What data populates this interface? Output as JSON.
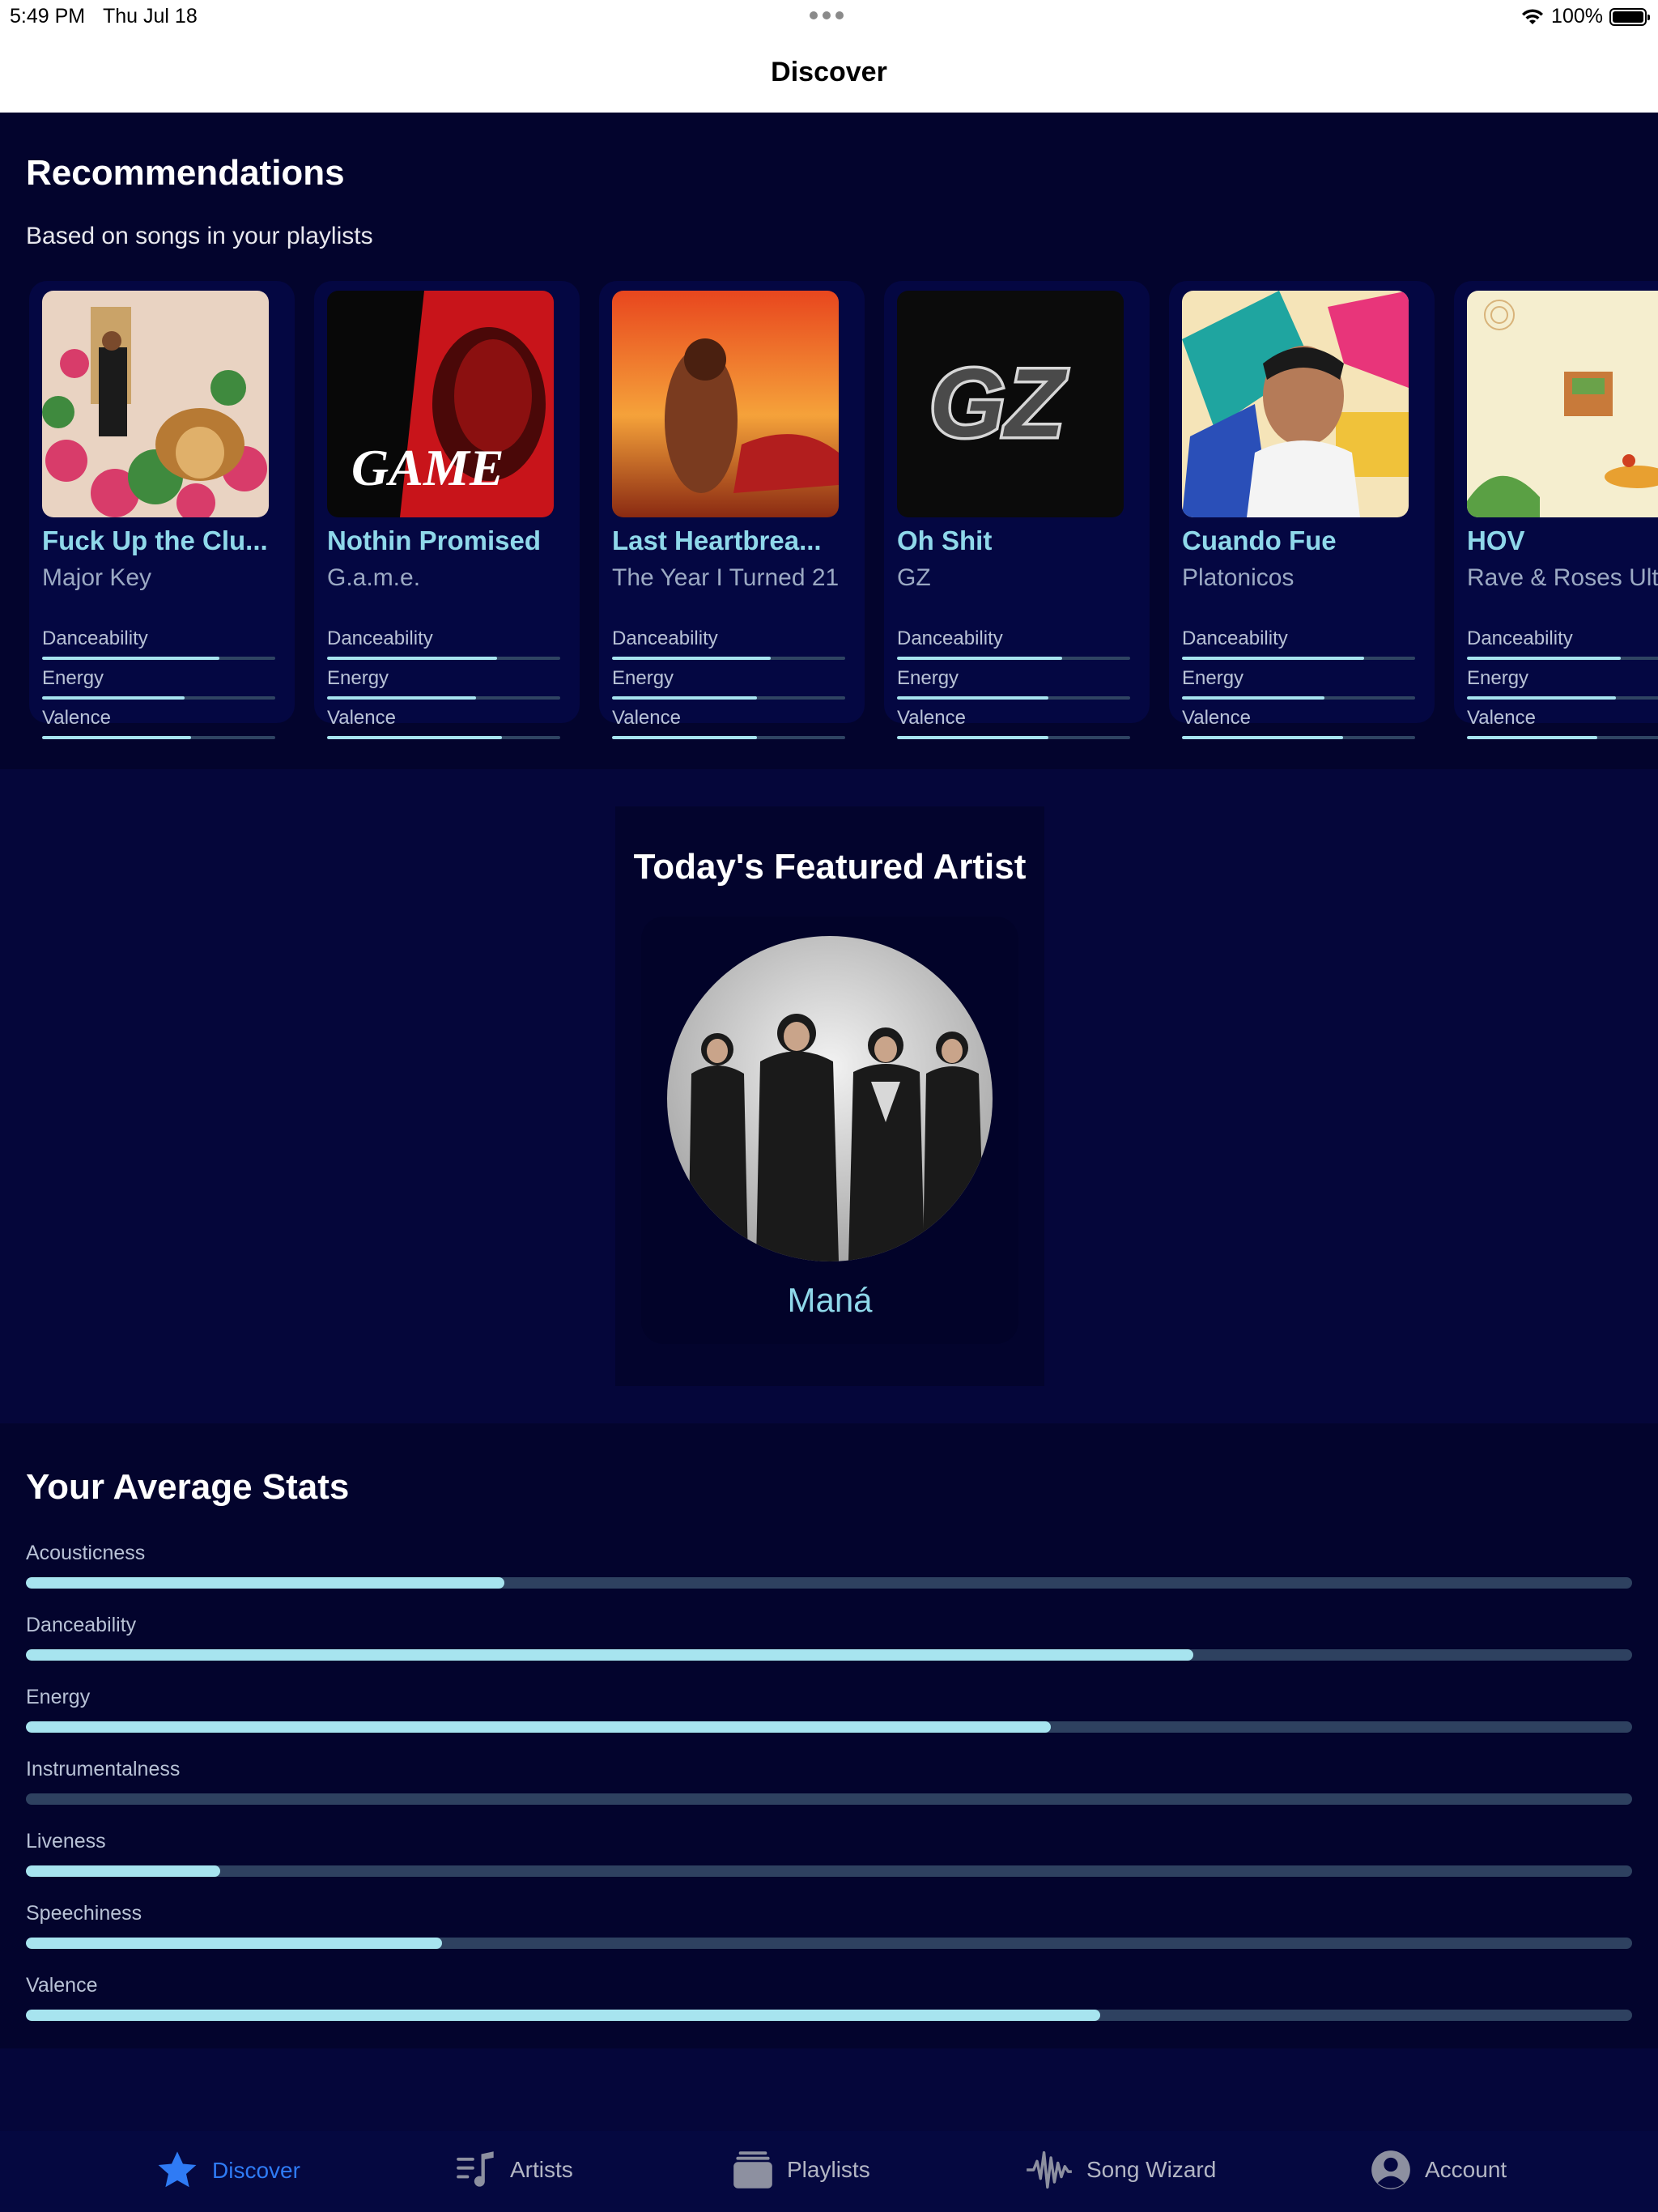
{
  "status": {
    "time": "5:49 PM",
    "date": "Thu Jul 18",
    "battery": "100%",
    "battery_level": 1.0
  },
  "nav": {
    "title": "Discover"
  },
  "recommendations": {
    "title": "Recommendations",
    "subtitle": "Based on songs in your playlists",
    "feature_labels": [
      "Danceability",
      "Energy",
      "Valence"
    ],
    "cards": [
      {
        "title": "Fuck Up the Clu...",
        "artist": "Major Key",
        "danceability": 0.76,
        "energy": 0.61,
        "valence": 0.64,
        "art": "garden"
      },
      {
        "title": "Nothin Promised",
        "artist": "G.a.m.e.",
        "danceability": 0.73,
        "energy": 0.64,
        "valence": 0.75,
        "art": "game"
      },
      {
        "title": "Last Heartbrea...",
        "artist": "The Year I Turned 21",
        "danceability": 0.68,
        "energy": 0.62,
        "valence": 0.62,
        "art": "sunset"
      },
      {
        "title": "Oh Shit",
        "artist": "GZ",
        "danceability": 0.71,
        "energy": 0.65,
        "valence": 0.65,
        "art": "chrome"
      },
      {
        "title": "Cuando Fue",
        "artist": "Platonicos",
        "danceability": 0.78,
        "energy": 0.61,
        "valence": 0.69,
        "art": "collage"
      },
      {
        "title": "HOV",
        "artist": "Rave & Roses Ultra",
        "danceability": 0.66,
        "energy": 0.64,
        "valence": 0.56,
        "art": "cream"
      }
    ]
  },
  "featured": {
    "title": "Today's Featured Artist",
    "artist": "Maná"
  },
  "stats": {
    "title": "Your Average Stats",
    "items": [
      {
        "label": "Acousticness",
        "value": 0.298
      },
      {
        "label": "Danceability",
        "value": 0.727
      },
      {
        "label": "Energy",
        "value": 0.638
      },
      {
        "label": "Instrumentalness",
        "value": 0.0
      },
      {
        "label": "Liveness",
        "value": 0.121
      },
      {
        "label": "Speechiness",
        "value": 0.259
      },
      {
        "label": "Valence",
        "value": 0.669
      }
    ]
  },
  "tabs": [
    {
      "label": "Discover",
      "icon": "star-icon",
      "active": true
    },
    {
      "label": "Artists",
      "icon": "music-list-icon",
      "active": false
    },
    {
      "label": "Playlists",
      "icon": "stack-icon",
      "active": false
    },
    {
      "label": "Song Wizard",
      "icon": "waveform-icon",
      "active": false
    },
    {
      "label": "Account",
      "icon": "person-circle-icon",
      "active": false
    }
  ]
}
